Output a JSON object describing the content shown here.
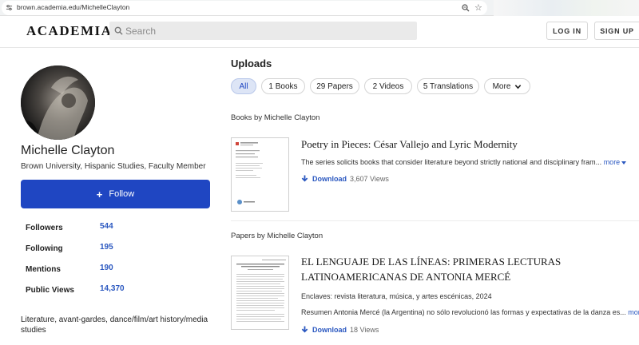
{
  "browser": {
    "url": "brown.academia.edu/MichelleClayton"
  },
  "header": {
    "logo": "ACADEMIA",
    "search_placeholder": "Search",
    "login_label": "LOG IN",
    "signup_label": "SIGN UP"
  },
  "profile": {
    "name": "Michelle Clayton",
    "affiliation": "Brown University, Hispanic Studies, Faculty Member",
    "follow_label": "Follow",
    "stats": [
      {
        "label": "Followers",
        "value": "544"
      },
      {
        "label": "Following",
        "value": "195"
      },
      {
        "label": "Mentions",
        "value": "190"
      },
      {
        "label": "Public Views",
        "value": "14,370"
      }
    ],
    "interests": "Literature, avant-gardes, dance/film/art history/media studies"
  },
  "uploads": {
    "title": "Uploads",
    "tabs": [
      {
        "label": "All",
        "active": true
      },
      {
        "label": "1 Books"
      },
      {
        "label": "29 Papers"
      },
      {
        "label": "2 Videos"
      },
      {
        "label": "5 Translations"
      },
      {
        "label": "More"
      }
    ],
    "books_label": "Books by Michelle Clayton",
    "papers_label": "Papers by Michelle Clayton",
    "book": {
      "title": "Poetry in Pieces: César Vallejo and Lyric Modernity",
      "description": "The series solicits books that consider literature beyond strictly national and disciplinary fram...",
      "more_label": "more",
      "download_label": "Download",
      "views": "3,607 Views"
    },
    "paper": {
      "title_line1": "EL LENGUAJE DE LAS LÍNEAS: PRIMERAS LECTURAS",
      "title_line2": "LATINOAMERICANAS DE ANTONIA MERCÉ",
      "venue": "Enclaves: revista literatura, música, y artes escénicas, 2024",
      "description": "Resumen Antonia Mercé (la Argentina) no sólo revolucionó las formas y expectativas de la danza es...",
      "more_label": "more",
      "download_label": "Download",
      "views": "18 Views"
    }
  },
  "colors": {
    "accent": "#1f46c2",
    "link": "#2b58c0"
  }
}
